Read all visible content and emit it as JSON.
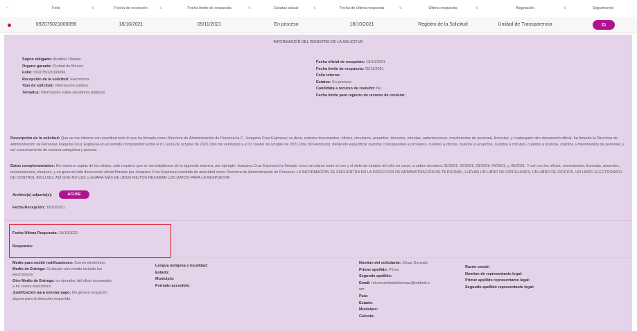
{
  "table": {
    "headers": [
      "~",
      "Folio",
      "Fecha de recepción",
      "Fecha límite de respuesta",
      "Estatus actual",
      "Fecha de última respuesta",
      "Última respuesta",
      "Asignación",
      "Seguimiento"
    ],
    "row": {
      "folio": "092075021000096",
      "fecha_recepcion": "18/10/2021",
      "fecha_limite": "05/11/2021",
      "estatus": "En proceso",
      "fecha_ultima": "18/10/2021",
      "ultima_respuesta": "Registro de la Solicitud",
      "asignacion": "Unidad de Transparencia",
      "seguimiento_icon": "document-icon",
      "seguimiento_glyph": "⧉"
    }
  },
  "panel": {
    "title": "INFORMACIÓN DEL REGISTRO DE LA SOLICITUD",
    "left_info": [
      {
        "label": "Sujeto obligado:",
        "value": " Alcaldía Tláhuac"
      },
      {
        "label": "Organo garante:",
        "value": " Ciudad de México"
      },
      {
        "label": "Folio:",
        "value": " 092075021000096"
      },
      {
        "label": "Recepción de la solicitud:",
        "value": " Electrónica"
      },
      {
        "label": "Tipo de solicitud:",
        "value": " Información pública"
      },
      {
        "label": "Temática:",
        "value": " Información sobre servidores públicos"
      }
    ],
    "right_info": [
      {
        "label": "Fecha oficial de recepción:",
        "value": " 18/10/2021"
      },
      {
        "label": "Fecha límite de respuesta:",
        "value": " 05/11/2021"
      },
      {
        "label": "Folio interno:",
        "value": ""
      },
      {
        "label": "Estatus:",
        "value": " En proceso"
      },
      {
        "label": "Candidata a recurso de revisión:",
        "value": " No"
      },
      {
        "label": "Fecha límite para registro de recurso de revisión:",
        "value": ""
      }
    ],
    "descripcion": {
      "label": "Descripción de la solicitud:",
      "text": " Que se me informe con exactitud todo lo que ha firmado como Directora de Administración de Personal la C. Joaquina Cruz Espinosa; es decir, cuántos documentos, oficios, circulares, acuerdos, decretos, minutas, autorizaciones, movimientos de personal, licencias, y cualesquier otro documento oficial, ha firmado la Directora de Administración de Personal Joaquina Cruz Espinosa en el periodo comprendido entre el 01 (uno) de octubre de 2021 (dos mil veintiuno) y el 07 (siete) de octubre de 2021 (dos mil veintiuno); debiendo especificar cuántos corresponden a circulares, cuántos a oficios, cuántos a acuerdos, cuántos a minutas, cuántos a licencia, cuántos a movimientos de personal, y así sucesivamente de manera categórica y precisa."
    },
    "datos": {
      "label": "Datos complementarios:",
      "text": " No requiero copias de los oficios, solo requiero que se me establezca de la siguiente manera, por ejemplo: Joaquina Cruz Espinosa ha firmado cinco circulares entre el uno y el siete de octubre del año en curso, a saber circulares 01/2021; 02/2021; 03/2021; 04/2021; y, 05/2021. Y así con los oficios, movimientos, licencias, acuerdos, autorizaciones, cheques, y en general todo documento oficial firmado por Joaquina Cruz Espinosa investida de autoridad como Directora de Administración de Personal. LA INFORMACIÓN SE ENCUENTRA EN LA DIRECCIÓN DE ADMINISTRACIÓN DE PERSONAL, LLEVAN UN LIBRO DE CIRCULARES, UN LIBRO DE OFICIOS, UN LIBRO ELECTRÓNICO DE CONTROL INCLUSO, ASÍ QUE NO LES LLEVARÁ MÁS DE UNOS MIUTOS RECABAR LOS DATOS PARA LA RESPUESTA."
    },
    "archivos_label": "Archivo(s) adjunto(s):",
    "acuse_label": "ACUSE",
    "fecha_recepcion": {
      "label": "Fecha Recepción:",
      "value": " 18/10/2021"
    },
    "fecha_ultima_respuesta": {
      "label": "Fecha Ultima Respuesta:",
      "value": " 18/10/2021"
    },
    "respuesta_label": "Respuesta:",
    "col1": [
      {
        "label": "Medio para recibir notificaciones:",
        "value": " Correo electrónico"
      },
      {
        "label": "Medio de Entrega:",
        "value": " Cualquier otro medio incluido los"
      },
      {
        "label": "",
        "value": "electrónicos"
      },
      {
        "label": "Otro Medio de Entrega:",
        "value": " un ejemplar del oficio escaneado"
      },
      {
        "label": "",
        "value": "a mi correo electrónico"
      },
      {
        "label": "Justificación para exentar pago:",
        "value": " No genera erogación"
      },
      {
        "label": "",
        "value": "alguna para la dirección requerida"
      }
    ],
    "col2": [
      {
        "label": "Lengua indígena o localidad:",
        "value": ""
      },
      {
        "label": "Estado:",
        "value": ""
      },
      {
        "label": "Municipio:",
        "value": ""
      },
      {
        "label": "Formato accesible:",
        "value": ""
      }
    ],
    "col3": [
      {
        "label": "Nombre del solicitante:",
        "value": " César Gonzalo"
      },
      {
        "label": "Primer apellido:",
        "value": " Pérez"
      },
      {
        "label": "Segundo apellido:",
        "value": ""
      },
      {
        "label": "Email:",
        "value": " micomunidaddetlahuac@outlook.c"
      },
      {
        "label": "",
        "value": "om"
      },
      {
        "label": "País:",
        "value": ""
      },
      {
        "label": "Estado:",
        "value": ""
      },
      {
        "label": "Municipio:",
        "value": ""
      },
      {
        "label": "Colonia:",
        "value": ""
      }
    ],
    "col4": [
      {
        "label": "Razón social:",
        "value": ""
      },
      {
        "label": "Nombre de representante legal:",
        "value": ""
      },
      {
        "label": "Primer apellido representante legal:",
        "value": ""
      },
      {
        "label": "Segundo apellido representante legal:",
        "value": ""
      }
    ]
  }
}
